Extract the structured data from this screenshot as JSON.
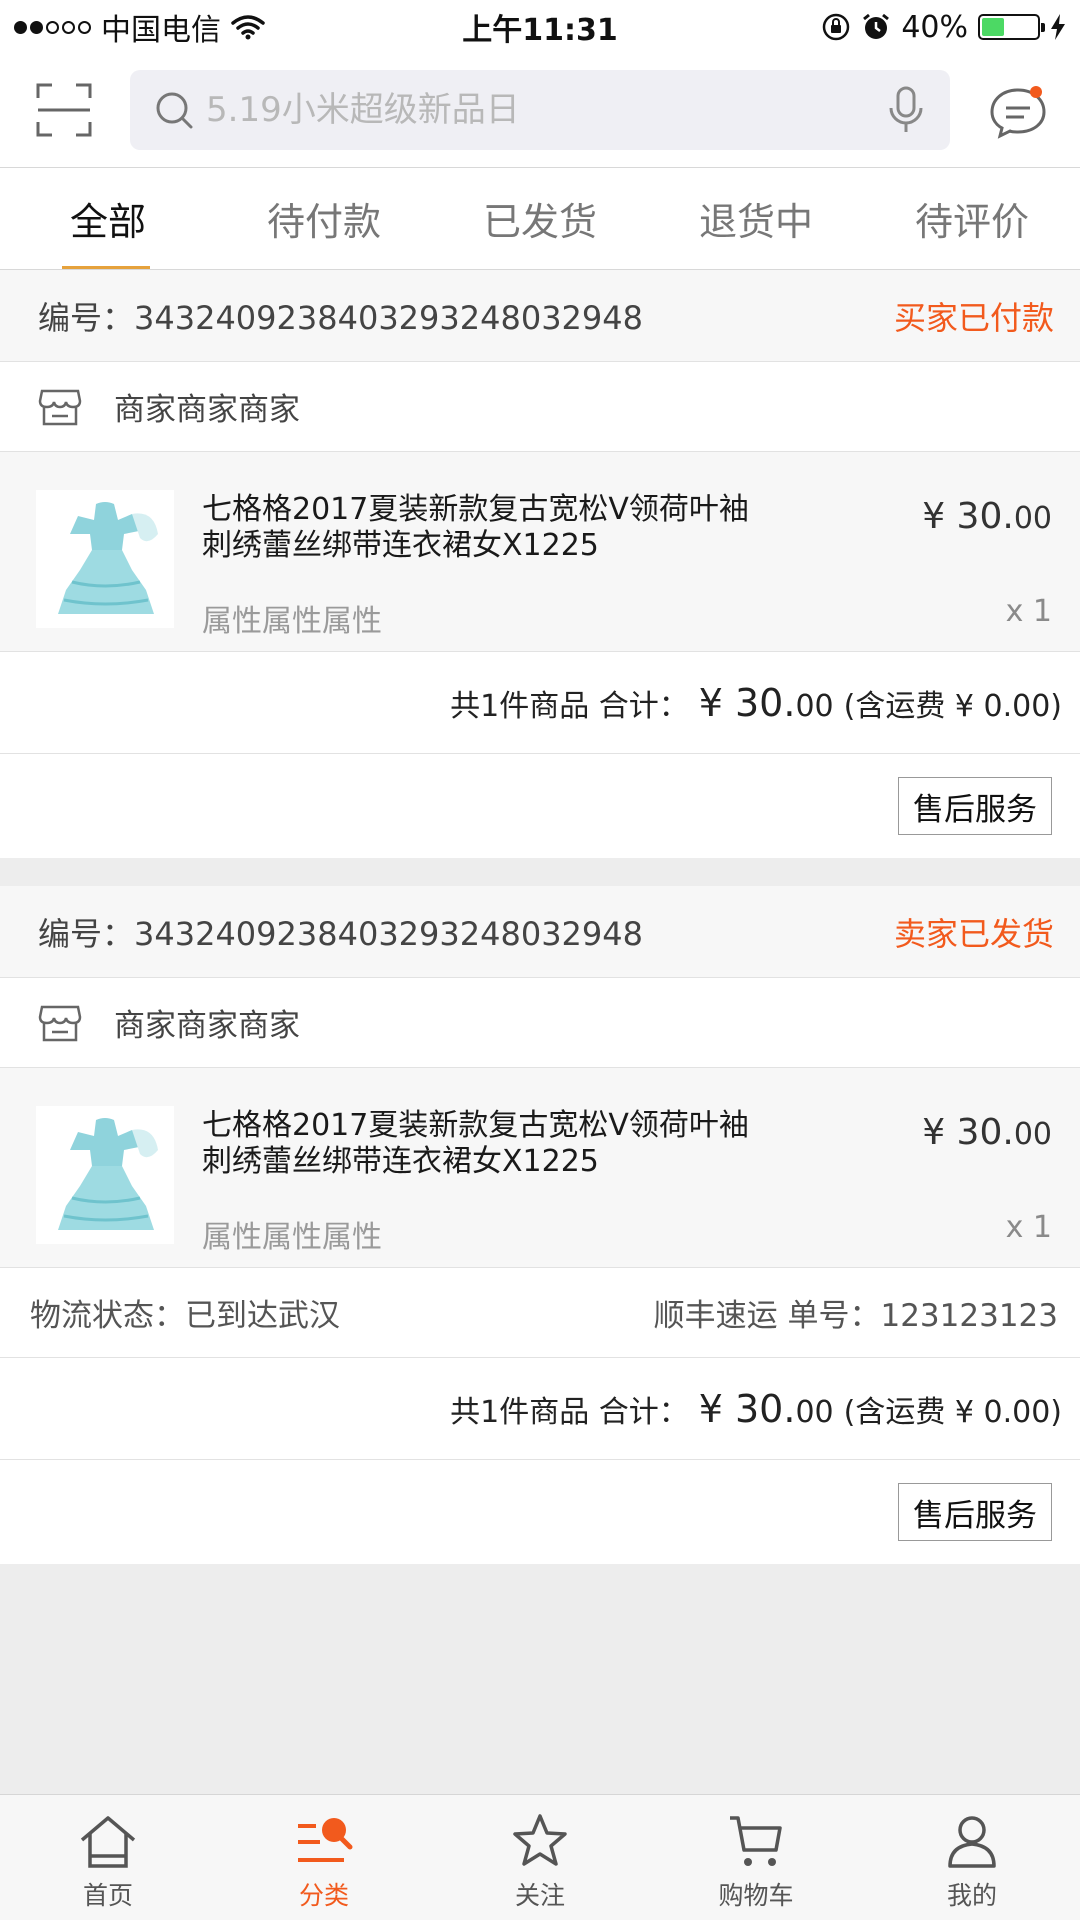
{
  "status_bar": {
    "carrier": "中国电信",
    "time": "上午11:31",
    "battery": "40%",
    "battery_level": 0.4,
    "signal_bars_on": 2,
    "signal_bars_total": 5
  },
  "header": {
    "search_placeholder": "5.19小米超级新品日"
  },
  "tabs": [
    {
      "label": "全部",
      "active": true
    },
    {
      "label": "待付款",
      "active": false
    },
    {
      "label": "已发货",
      "active": false
    },
    {
      "label": "退货中",
      "active": false
    },
    {
      "label": "待评价",
      "active": false
    }
  ],
  "orders": [
    {
      "number": "编号：343240923840329324803294​8",
      "status": "买家已付款",
      "shop": "商家商家商家",
      "item": {
        "title": "七格格2017夏装新款复古宽松V领荷叶袖刺绣蕾丝绑带连衣裙女X1225",
        "attr": "属性属性属性",
        "price_main": "¥ 30.",
        "price_cents": "00",
        "qty": "x 1"
      },
      "summary_count": "共1件商品 合计：",
      "summary_amount_main": "¥ 30.",
      "summary_amount_cents": "00",
      "summary_shipping": "(含运费 ¥ 0.00)",
      "action": "售后服务"
    },
    {
      "number": "编号：343240923840329324803294​8",
      "status": "卖家已发货",
      "shop": "商家商家商家",
      "item": {
        "title": "七格格2017夏装新款复古宽松V领荷叶袖刺绣蕾丝绑带连衣裙女X1225",
        "attr": "属性属性属性",
        "price_main": "¥ 30.",
        "price_cents": "00",
        "qty": "x 1"
      },
      "logistics_status": "物流状态：已到达武汉",
      "logistics_carrier": "顺丰速运 单号：123123123",
      "summary_count": "共1件商品 合计：",
      "summary_amount_main": "¥ 30.",
      "summary_amount_cents": "00",
      "summary_shipping": "(含运费 ¥ 0.00)",
      "action": "售后服务"
    }
  ],
  "tabbar": [
    {
      "label": "首页",
      "icon": "home-icon"
    },
    {
      "label": "分类",
      "icon": "category-search-icon",
      "active": true
    },
    {
      "label": "关注",
      "icon": "star-icon"
    },
    {
      "label": "购物车",
      "icon": "cart-icon"
    },
    {
      "label": "我的",
      "icon": "user-icon"
    }
  ],
  "colors": {
    "accent": "#f25a1d",
    "tab_underline": "#e6a23c",
    "dress": "#8fd3dc"
  }
}
